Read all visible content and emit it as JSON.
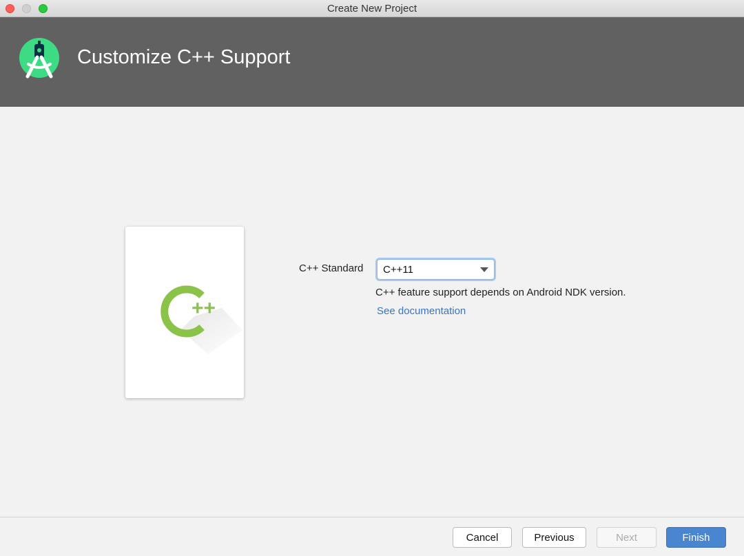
{
  "window": {
    "title": "Create New Project"
  },
  "header": {
    "title": "Customize C++ Support",
    "logo_icon": "android-studio-icon",
    "background_color": "#616161"
  },
  "illustration": {
    "icon": "cpp-icon",
    "text": "++",
    "accent_color": "#8bc34a"
  },
  "form": {
    "cpp_standard_label": "C++ Standard",
    "cpp_standard_value": "C++11",
    "help_text": "C++ feature support depends on Android NDK version.",
    "doc_link": "See documentation"
  },
  "buttons": {
    "cancel": "Cancel",
    "previous": "Previous",
    "next": "Next",
    "finish": "Finish"
  },
  "colors": {
    "link": "#3a74c4",
    "primary_button": "#4a86cf"
  }
}
